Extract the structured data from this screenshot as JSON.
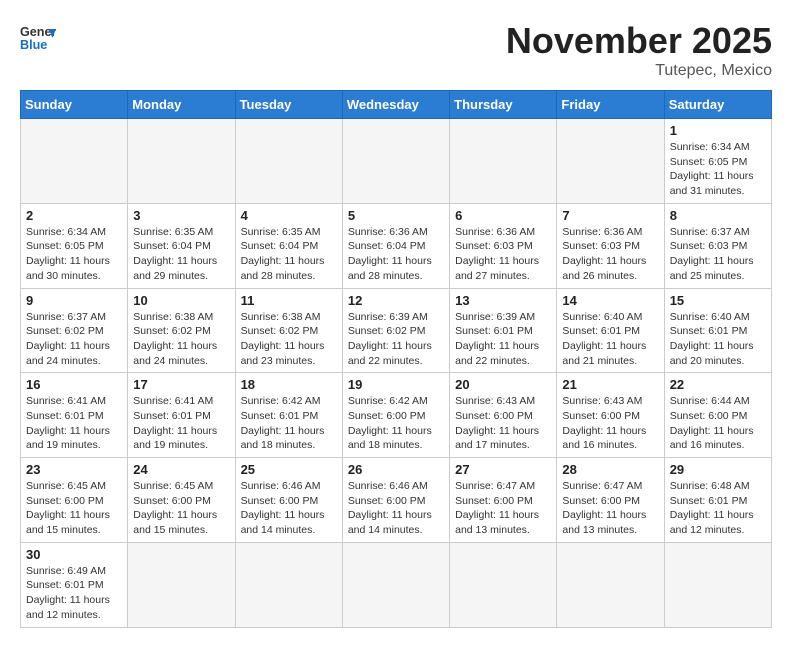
{
  "header": {
    "logo_line1": "General",
    "logo_line2": "Blue",
    "month": "November 2025",
    "location": "Tutepec, Mexico"
  },
  "weekdays": [
    "Sunday",
    "Monday",
    "Tuesday",
    "Wednesday",
    "Thursday",
    "Friday",
    "Saturday"
  ],
  "weeks": [
    [
      {
        "day": "",
        "info": ""
      },
      {
        "day": "",
        "info": ""
      },
      {
        "day": "",
        "info": ""
      },
      {
        "day": "",
        "info": ""
      },
      {
        "day": "",
        "info": ""
      },
      {
        "day": "",
        "info": ""
      },
      {
        "day": "1",
        "info": "Sunrise: 6:34 AM\nSunset: 6:05 PM\nDaylight: 11 hours\nand 31 minutes."
      }
    ],
    [
      {
        "day": "2",
        "info": "Sunrise: 6:34 AM\nSunset: 6:05 PM\nDaylight: 11 hours\nand 30 minutes."
      },
      {
        "day": "3",
        "info": "Sunrise: 6:35 AM\nSunset: 6:04 PM\nDaylight: 11 hours\nand 29 minutes."
      },
      {
        "day": "4",
        "info": "Sunrise: 6:35 AM\nSunset: 6:04 PM\nDaylight: 11 hours\nand 28 minutes."
      },
      {
        "day": "5",
        "info": "Sunrise: 6:36 AM\nSunset: 6:04 PM\nDaylight: 11 hours\nand 28 minutes."
      },
      {
        "day": "6",
        "info": "Sunrise: 6:36 AM\nSunset: 6:03 PM\nDaylight: 11 hours\nand 27 minutes."
      },
      {
        "day": "7",
        "info": "Sunrise: 6:36 AM\nSunset: 6:03 PM\nDaylight: 11 hours\nand 26 minutes."
      },
      {
        "day": "8",
        "info": "Sunrise: 6:37 AM\nSunset: 6:03 PM\nDaylight: 11 hours\nand 25 minutes."
      }
    ],
    [
      {
        "day": "9",
        "info": "Sunrise: 6:37 AM\nSunset: 6:02 PM\nDaylight: 11 hours\nand 24 minutes."
      },
      {
        "day": "10",
        "info": "Sunrise: 6:38 AM\nSunset: 6:02 PM\nDaylight: 11 hours\nand 24 minutes."
      },
      {
        "day": "11",
        "info": "Sunrise: 6:38 AM\nSunset: 6:02 PM\nDaylight: 11 hours\nand 23 minutes."
      },
      {
        "day": "12",
        "info": "Sunrise: 6:39 AM\nSunset: 6:02 PM\nDaylight: 11 hours\nand 22 minutes."
      },
      {
        "day": "13",
        "info": "Sunrise: 6:39 AM\nSunset: 6:01 PM\nDaylight: 11 hours\nand 22 minutes."
      },
      {
        "day": "14",
        "info": "Sunrise: 6:40 AM\nSunset: 6:01 PM\nDaylight: 11 hours\nand 21 minutes."
      },
      {
        "day": "15",
        "info": "Sunrise: 6:40 AM\nSunset: 6:01 PM\nDaylight: 11 hours\nand 20 minutes."
      }
    ],
    [
      {
        "day": "16",
        "info": "Sunrise: 6:41 AM\nSunset: 6:01 PM\nDaylight: 11 hours\nand 19 minutes."
      },
      {
        "day": "17",
        "info": "Sunrise: 6:41 AM\nSunset: 6:01 PM\nDaylight: 11 hours\nand 19 minutes."
      },
      {
        "day": "18",
        "info": "Sunrise: 6:42 AM\nSunset: 6:01 PM\nDaylight: 11 hours\nand 18 minutes."
      },
      {
        "day": "19",
        "info": "Sunrise: 6:42 AM\nSunset: 6:00 PM\nDaylight: 11 hours\nand 18 minutes."
      },
      {
        "day": "20",
        "info": "Sunrise: 6:43 AM\nSunset: 6:00 PM\nDaylight: 11 hours\nand 17 minutes."
      },
      {
        "day": "21",
        "info": "Sunrise: 6:43 AM\nSunset: 6:00 PM\nDaylight: 11 hours\nand 16 minutes."
      },
      {
        "day": "22",
        "info": "Sunrise: 6:44 AM\nSunset: 6:00 PM\nDaylight: 11 hours\nand 16 minutes."
      }
    ],
    [
      {
        "day": "23",
        "info": "Sunrise: 6:45 AM\nSunset: 6:00 PM\nDaylight: 11 hours\nand 15 minutes."
      },
      {
        "day": "24",
        "info": "Sunrise: 6:45 AM\nSunset: 6:00 PM\nDaylight: 11 hours\nand 15 minutes."
      },
      {
        "day": "25",
        "info": "Sunrise: 6:46 AM\nSunset: 6:00 PM\nDaylight: 11 hours\nand 14 minutes."
      },
      {
        "day": "26",
        "info": "Sunrise: 6:46 AM\nSunset: 6:00 PM\nDaylight: 11 hours\nand 14 minutes."
      },
      {
        "day": "27",
        "info": "Sunrise: 6:47 AM\nSunset: 6:00 PM\nDaylight: 11 hours\nand 13 minutes."
      },
      {
        "day": "28",
        "info": "Sunrise: 6:47 AM\nSunset: 6:00 PM\nDaylight: 11 hours\nand 13 minutes."
      },
      {
        "day": "29",
        "info": "Sunrise: 6:48 AM\nSunset: 6:01 PM\nDaylight: 11 hours\nand 12 minutes."
      }
    ],
    [
      {
        "day": "30",
        "info": "Sunrise: 6:49 AM\nSunset: 6:01 PM\nDaylight: 11 hours\nand 12 minutes."
      },
      {
        "day": "",
        "info": ""
      },
      {
        "day": "",
        "info": ""
      },
      {
        "day": "",
        "info": ""
      },
      {
        "day": "",
        "info": ""
      },
      {
        "day": "",
        "info": ""
      },
      {
        "day": "",
        "info": ""
      }
    ]
  ]
}
